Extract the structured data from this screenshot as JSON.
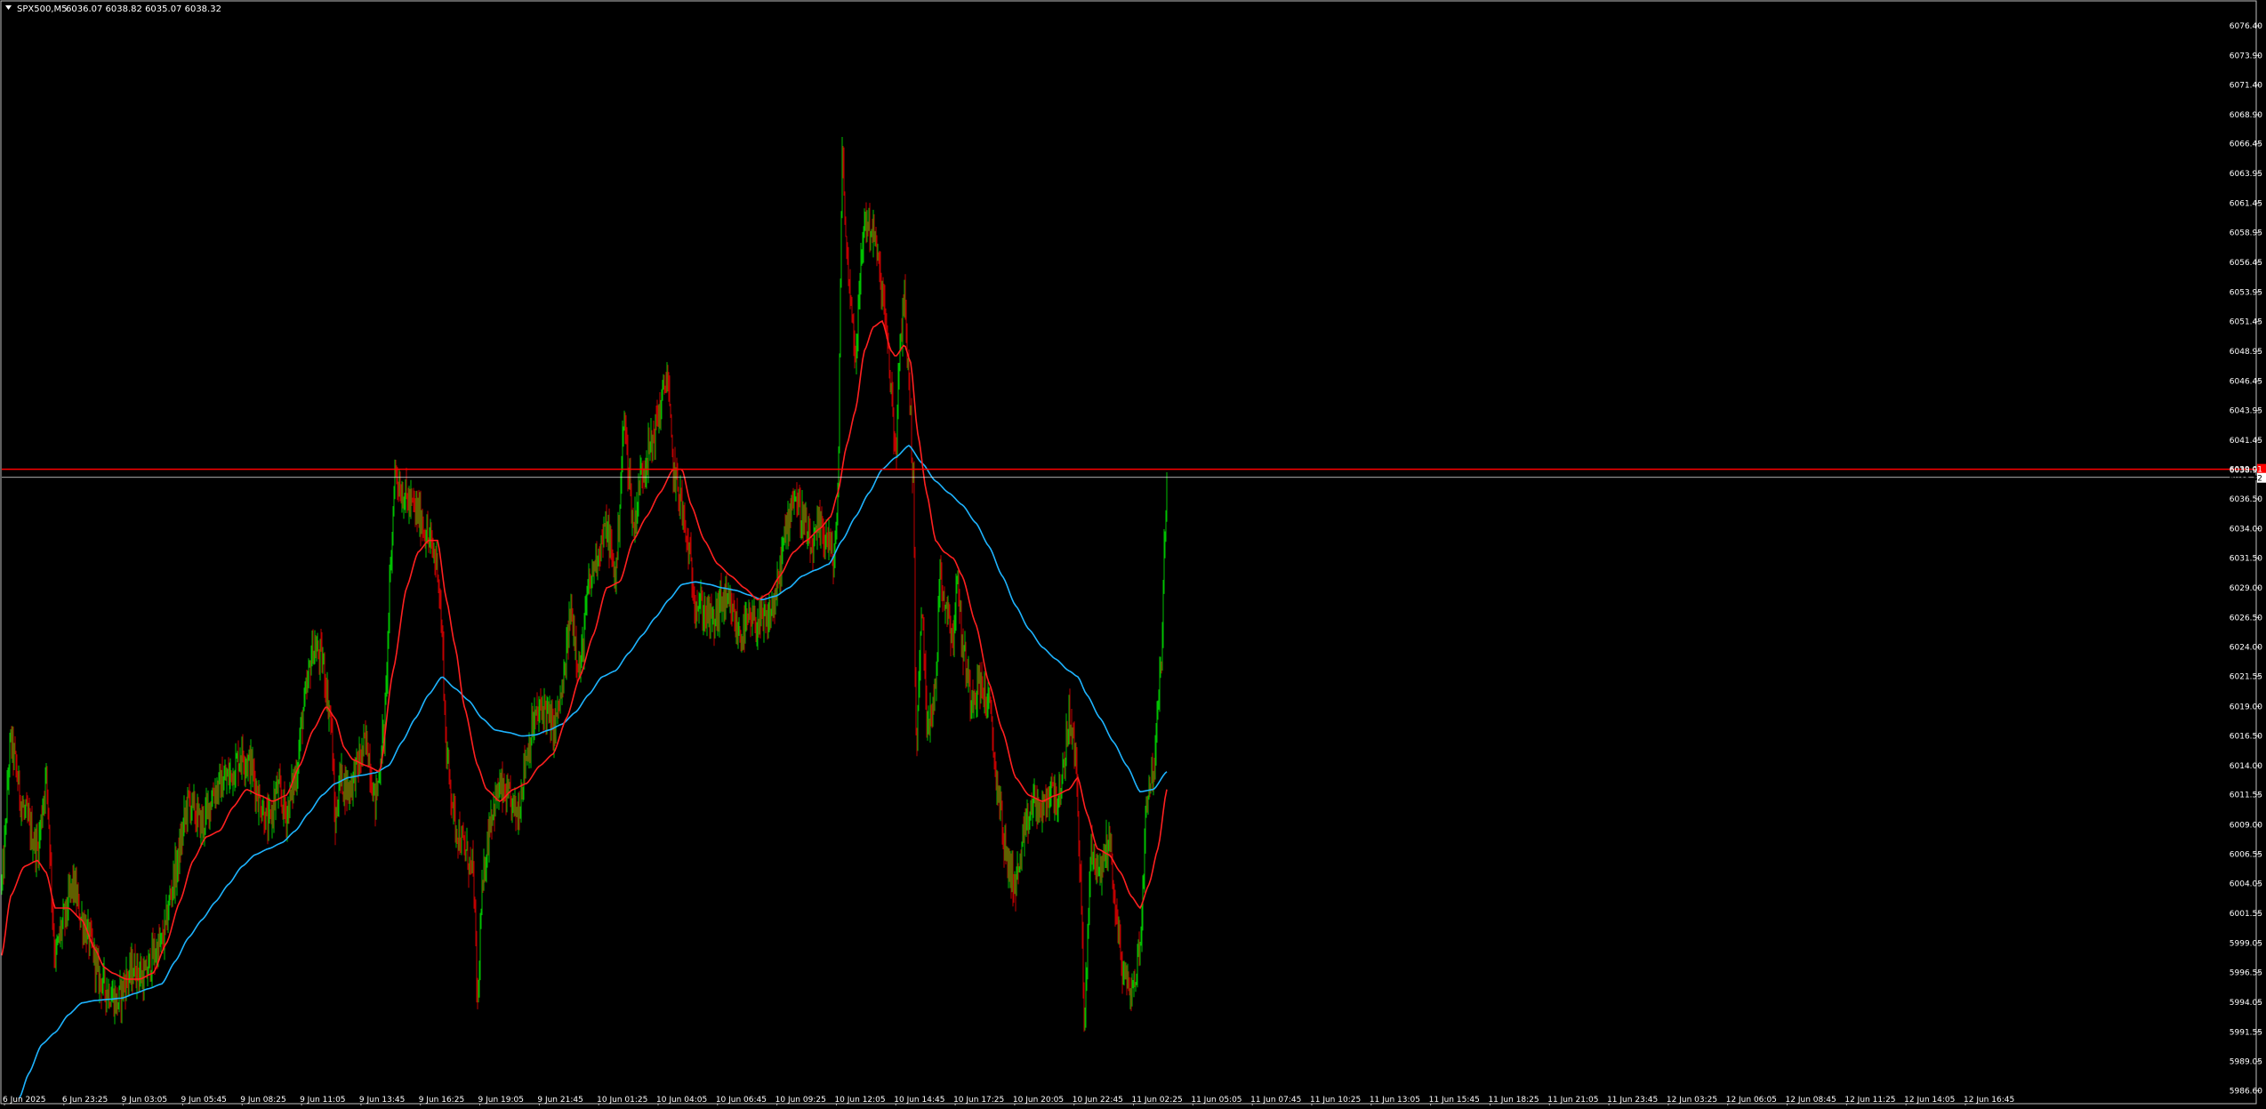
{
  "header": {
    "symbol": "SPX500,M5",
    "ohlc": "6036.07 6038.82 6035.07 6038.32",
    "menu_icon": "triangle-down-icon"
  },
  "colors": {
    "background": "#000000",
    "frame": "#c0c0c0",
    "text": "#ffffff",
    "candle_up": "#00c000",
    "candle_down": "#c00000",
    "ma_fast": "#ff2020",
    "ma_slow": "#1eb4ff",
    "level_line": "#ff0000",
    "price_label_bg": "#ffffff",
    "price_label_text": "#000000",
    "level_label_bg": "#ff0000"
  },
  "chart_data": {
    "type": "candlestick",
    "title": "",
    "xlabel": "",
    "ylabel": "",
    "ylim": [
      5985.5,
      6078.5
    ],
    "y_ticks": [
      "6076.40",
      "6073.90",
      "6071.40",
      "6068.90",
      "6066.45",
      "6063.95",
      "6061.45",
      "6058.95",
      "6056.45",
      "6053.95",
      "6051.45",
      "6048.95",
      "6046.45",
      "6043.95",
      "6041.45",
      "6038.95",
      "6036.50",
      "6034.00",
      "6031.50",
      "6029.00",
      "6026.50",
      "6024.00",
      "6021.55",
      "6019.00",
      "6016.50",
      "6014.00",
      "6011.55",
      "6009.00",
      "6006.55",
      "6004.05",
      "6001.55",
      "5999.05",
      "5996.55",
      "5994.05",
      "5991.55",
      "5989.05",
      "5986.60"
    ],
    "x_ticks": [
      "6 Jun 2025",
      "6 Jun 23:25",
      "9 Jun 03:05",
      "9 Jun 05:45",
      "9 Jun 08:25",
      "9 Jun 11:05",
      "9 Jun 13:45",
      "9 Jun 16:25",
      "9 Jun 19:05",
      "9 Jun 21:45",
      "10 Jun 01:25",
      "10 Jun 04:05",
      "10 Jun 06:45",
      "10 Jun 09:25",
      "10 Jun 12:05",
      "10 Jun 14:45",
      "10 Jun 17:25",
      "10 Jun 20:05",
      "10 Jun 22:45",
      "11 Jun 02:25",
      "11 Jun 05:05",
      "11 Jun 07:45",
      "11 Jun 10:25",
      "11 Jun 13:05",
      "11 Jun 15:45",
      "11 Jun 18:25",
      "11 Jun 21:05",
      "11 Jun 23:45",
      "12 Jun 03:25",
      "12 Jun 06:05",
      "12 Jun 08:45",
      "12 Jun 11:25",
      "12 Jun 14:05",
      "12 Jun 16:45"
    ],
    "close_anchors": [
      [
        0,
        6004
      ],
      [
        10,
        6016
      ],
      [
        25,
        6010
      ],
      [
        40,
        6007
      ],
      [
        50,
        6013
      ],
      [
        60,
        5998
      ],
      [
        70,
        6001
      ],
      [
        80,
        6004
      ],
      [
        90,
        6001
      ],
      [
        100,
        5999
      ],
      [
        110,
        5996
      ],
      [
        120,
        5995
      ],
      [
        130,
        5994
      ],
      [
        140,
        5996
      ],
      [
        150,
        5997
      ],
      [
        160,
        5996
      ],
      [
        170,
        5998
      ],
      [
        180,
        5999
      ],
      [
        195,
        6005
      ],
      [
        210,
        6011
      ],
      [
        225,
        6009
      ],
      [
        240,
        6012
      ],
      [
        255,
        6013
      ],
      [
        270,
        6015
      ],
      [
        280,
        6014
      ],
      [
        290,
        6011
      ],
      [
        300,
        6009
      ],
      [
        310,
        6012
      ],
      [
        320,
        6010
      ],
      [
        330,
        6013
      ],
      [
        340,
        6019
      ],
      [
        350,
        6024
      ],
      [
        360,
        6023
      ],
      [
        370,
        6018
      ],
      [
        375,
        6009
      ],
      [
        380,
        6013
      ],
      [
        390,
        6012
      ],
      [
        400,
        6014
      ],
      [
        410,
        6016
      ],
      [
        420,
        6011
      ],
      [
        430,
        6017
      ],
      [
        437,
        6030
      ],
      [
        442,
        6039
      ],
      [
        450,
        6037
      ],
      [
        460,
        6036
      ],
      [
        470,
        6035
      ],
      [
        480,
        6033
      ],
      [
        490,
        6031
      ],
      [
        495,
        6025
      ],
      [
        500,
        6015
      ],
      [
        505,
        6012
      ],
      [
        510,
        6009
      ],
      [
        520,
        6007
      ],
      [
        530,
        6005
      ],
      [
        535,
        5994
      ],
      [
        540,
        6003
      ],
      [
        545,
        6007
      ],
      [
        550,
        6010
      ],
      [
        560,
        6012
      ],
      [
        570,
        6011
      ],
      [
        580,
        6010
      ],
      [
        590,
        6015
      ],
      [
        600,
        6018
      ],
      [
        610,
        6019
      ],
      [
        620,
        6017
      ],
      [
        630,
        6020
      ],
      [
        640,
        6027
      ],
      [
        650,
        6022
      ],
      [
        660,
        6029
      ],
      [
        670,
        6032
      ],
      [
        680,
        6034
      ],
      [
        690,
        6030
      ],
      [
        700,
        6043
      ],
      [
        705,
        6039
      ],
      [
        710,
        6034
      ],
      [
        720,
        6039
      ],
      [
        730,
        6041
      ],
      [
        740,
        6044
      ],
      [
        748,
        6047
      ],
      [
        755,
        6039
      ],
      [
        762,
        6037
      ],
      [
        770,
        6033
      ],
      [
        780,
        6028
      ],
      [
        790,
        6027
      ],
      [
        800,
        6026
      ],
      [
        810,
        6028
      ],
      [
        820,
        6027
      ],
      [
        830,
        6025
      ],
      [
        840,
        6026
      ],
      [
        850,
        6026
      ],
      [
        860,
        6026
      ],
      [
        870,
        6028
      ],
      [
        880,
        6033
      ],
      [
        890,
        6037
      ],
      [
        900,
        6035
      ],
      [
        910,
        6032
      ],
      [
        920,
        6034
      ],
      [
        930,
        6033
      ],
      [
        935,
        6031
      ],
      [
        940,
        6036
      ],
      [
        945,
        6066
      ],
      [
        950,
        6057
      ],
      [
        960,
        6049
      ],
      [
        970,
        6060
      ],
      [
        980,
        6059
      ],
      [
        990,
        6054
      ],
      [
        1000,
        6046
      ],
      [
        1005,
        6040
      ],
      [
        1010,
        6049
      ],
      [
        1015,
        6054
      ],
      [
        1020,
        6046
      ],
      [
        1025,
        6038
      ],
      [
        1028,
        6016
      ],
      [
        1035,
        6027
      ],
      [
        1040,
        6018
      ],
      [
        1050,
        6020
      ],
      [
        1055,
        6031
      ],
      [
        1060,
        6028
      ],
      [
        1070,
        6025
      ],
      [
        1075,
        6030
      ],
      [
        1080,
        6024
      ],
      [
        1090,
        6020
      ],
      [
        1100,
        6021
      ],
      [
        1110,
        6019
      ],
      [
        1120,
        6012
      ],
      [
        1130,
        6006
      ],
      [
        1140,
        6004
      ],
      [
        1150,
        6008
      ],
      [
        1160,
        6011
      ],
      [
        1170,
        6010
      ],
      [
        1180,
        6012
      ],
      [
        1190,
        6011
      ],
      [
        1200,
        6018
      ],
      [
        1207,
        6015
      ],
      [
        1213,
        6005
      ],
      [
        1217,
        5992
      ],
      [
        1225,
        6007
      ],
      [
        1235,
        6005
      ],
      [
        1245,
        6008
      ],
      [
        1255,
        6000
      ],
      [
        1262,
        5996
      ],
      [
        1272,
        5995
      ],
      [
        1280,
        5999
      ],
      [
        1288,
        6012
      ],
      [
        1296,
        6014
      ],
      [
        1303,
        6022
      ],
      [
        1310,
        6038.32
      ]
    ],
    "ma_fast_anchors": [
      [
        0,
        5998
      ],
      [
        10,
        6003
      ],
      [
        25,
        6005.5
      ],
      [
        40,
        6006
      ],
      [
        50,
        6005
      ],
      [
        60,
        6002
      ],
      [
        75,
        6002
      ],
      [
        90,
        6001
      ],
      [
        105,
        5998.5
      ],
      [
        115,
        5997
      ],
      [
        125,
        5996.5
      ],
      [
        140,
        5996
      ],
      [
        155,
        5996
      ],
      [
        170,
        5996.5
      ],
      [
        185,
        5999
      ],
      [
        200,
        6002.5
      ],
      [
        215,
        6006
      ],
      [
        230,
        6008
      ],
      [
        245,
        6008.5
      ],
      [
        260,
        6010.5
      ],
      [
        275,
        6012
      ],
      [
        290,
        6011.5
      ],
      [
        305,
        6011
      ],
      [
        320,
        6011.5
      ],
      [
        335,
        6014
      ],
      [
        350,
        6017
      ],
      [
        365,
        6019
      ],
      [
        375,
        6018
      ],
      [
        385,
        6015.5
      ],
      [
        395,
        6014.5
      ],
      [
        410,
        6014
      ],
      [
        425,
        6013.5
      ],
      [
        440,
        6022
      ],
      [
        455,
        6029
      ],
      [
        468,
        6032
      ],
      [
        480,
        6033
      ],
      [
        490,
        6033
      ],
      [
        500,
        6028
      ],
      [
        510,
        6024
      ],
      [
        520,
        6019
      ],
      [
        535,
        6014
      ],
      [
        545,
        6012
      ],
      [
        560,
        6011
      ],
      [
        575,
        6012
      ],
      [
        590,
        6012.5
      ],
      [
        605,
        6014
      ],
      [
        620,
        6015
      ],
      [
        635,
        6018
      ],
      [
        650,
        6021.5
      ],
      [
        665,
        6025
      ],
      [
        680,
        6029
      ],
      [
        695,
        6029.5
      ],
      [
        710,
        6033
      ],
      [
        725,
        6035
      ],
      [
        740,
        6037
      ],
      [
        755,
        6039
      ],
      [
        765,
        6039
      ],
      [
        775,
        6036
      ],
      [
        790,
        6033
      ],
      [
        805,
        6031
      ],
      [
        820,
        6030
      ],
      [
        835,
        6029
      ],
      [
        850,
        6028
      ],
      [
        862,
        6028.5
      ],
      [
        875,
        6030
      ],
      [
        890,
        6032
      ],
      [
        905,
        6033
      ],
      [
        920,
        6034
      ],
      [
        932,
        6035
      ],
      [
        940,
        6037
      ],
      [
        950,
        6041
      ],
      [
        960,
        6044
      ],
      [
        970,
        6049
      ],
      [
        980,
        6051
      ],
      [
        990,
        6051.5
      ],
      [
        1000,
        6049
      ],
      [
        1005,
        6048.5
      ],
      [
        1015,
        6049.5
      ],
      [
        1022,
        6048
      ],
      [
        1030,
        6042
      ],
      [
        1040,
        6037
      ],
      [
        1050,
        6033
      ],
      [
        1060,
        6032
      ],
      [
        1070,
        6031.5
      ],
      [
        1080,
        6030
      ],
      [
        1095,
        6026
      ],
      [
        1110,
        6021
      ],
      [
        1125,
        6017
      ],
      [
        1140,
        6013
      ],
      [
        1155,
        6011.5
      ],
      [
        1170,
        6011
      ],
      [
        1185,
        6011.5
      ],
      [
        1200,
        6012
      ],
      [
        1210,
        6013
      ],
      [
        1220,
        6010
      ],
      [
        1232,
        6007
      ],
      [
        1245,
        6006.5
      ],
      [
        1258,
        6005
      ],
      [
        1270,
        6003
      ],
      [
        1280,
        6002
      ],
      [
        1290,
        6004
      ],
      [
        1300,
        6007
      ],
      [
        1310,
        6012
      ]
    ],
    "ma_slow_anchors": [
      [
        20,
        5986
      ],
      [
        30,
        5988
      ],
      [
        45,
        5990.5
      ],
      [
        60,
        5991.5
      ],
      [
        75,
        5993
      ],
      [
        90,
        5994
      ],
      [
        105,
        5994.2
      ],
      [
        120,
        5994.3
      ],
      [
        135,
        5994.4
      ],
      [
        150,
        5994.8
      ],
      [
        165,
        5995.2
      ],
      [
        180,
        5995.6
      ],
      [
        195,
        5997.5
      ],
      [
        210,
        5999.5
      ],
      [
        225,
        6001
      ],
      [
        240,
        6002.5
      ],
      [
        255,
        6004
      ],
      [
        270,
        6005.5
      ],
      [
        285,
        6006.5
      ],
      [
        300,
        6007
      ],
      [
        315,
        6007.5
      ],
      [
        330,
        6008.5
      ],
      [
        345,
        6010
      ],
      [
        360,
        6011.5
      ],
      [
        375,
        6012.5
      ],
      [
        390,
        6013
      ],
      [
        405,
        6013.2
      ],
      [
        420,
        6013.4
      ],
      [
        435,
        6014
      ],
      [
        450,
        6016
      ],
      [
        465,
        6018
      ],
      [
        480,
        6020
      ],
      [
        495,
        6021.5
      ],
      [
        510,
        6020.5
      ],
      [
        525,
        6019.5
      ],
      [
        540,
        6018
      ],
      [
        555,
        6017
      ],
      [
        570,
        6016.8
      ],
      [
        585,
        6016.5
      ],
      [
        600,
        6016.6
      ],
      [
        615,
        6017
      ],
      [
        630,
        6017.5
      ],
      [
        645,
        6018.5
      ],
      [
        660,
        6020
      ],
      [
        675,
        6021.5
      ],
      [
        690,
        6022
      ],
      [
        705,
        6023.5
      ],
      [
        720,
        6025
      ],
      [
        735,
        6026.5
      ],
      [
        750,
        6028
      ],
      [
        765,
        6029.3
      ],
      [
        780,
        6029.5
      ],
      [
        795,
        6029.3
      ],
      [
        810,
        6029
      ],
      [
        825,
        6028.8
      ],
      [
        840,
        6028.4
      ],
      [
        855,
        6028
      ],
      [
        870,
        6028.3
      ],
      [
        885,
        6029
      ],
      [
        900,
        6030
      ],
      [
        915,
        6030.5
      ],
      [
        930,
        6031
      ],
      [
        945,
        6033
      ],
      [
        960,
        6035
      ],
      [
        975,
        6037
      ],
      [
        990,
        6039
      ],
      [
        1005,
        6040
      ],
      [
        1020,
        6041
      ],
      [
        1035,
        6039.5
      ],
      [
        1050,
        6038
      ],
      [
        1065,
        6037
      ],
      [
        1080,
        6036
      ],
      [
        1095,
        6034.5
      ],
      [
        1110,
        6032.5
      ],
      [
        1125,
        6030
      ],
      [
        1140,
        6027.5
      ],
      [
        1155,
        6025.5
      ],
      [
        1170,
        6024
      ],
      [
        1185,
        6023
      ],
      [
        1200,
        6022
      ],
      [
        1210,
        6021.5
      ],
      [
        1220,
        6020
      ],
      [
        1235,
        6018
      ],
      [
        1250,
        6016
      ],
      [
        1265,
        6014
      ],
      [
        1280,
        6011.8
      ],
      [
        1295,
        6012
      ],
      [
        1310,
        6013.5
      ]
    ],
    "series": [
      {
        "name": "",
        "kind": "candles",
        "color": "#00c000"
      },
      {
        "name": "",
        "kind": "moving-average",
        "color": "#ff2020"
      },
      {
        "name": "",
        "kind": "moving-average",
        "color": "#1eb4ff"
      }
    ],
    "level_line": {
      "value": 6039.0,
      "label": "6039.01"
    },
    "current_price": {
      "value": 6038.32,
      "label": "6038.32"
    },
    "grid": false,
    "legend": "none"
  }
}
